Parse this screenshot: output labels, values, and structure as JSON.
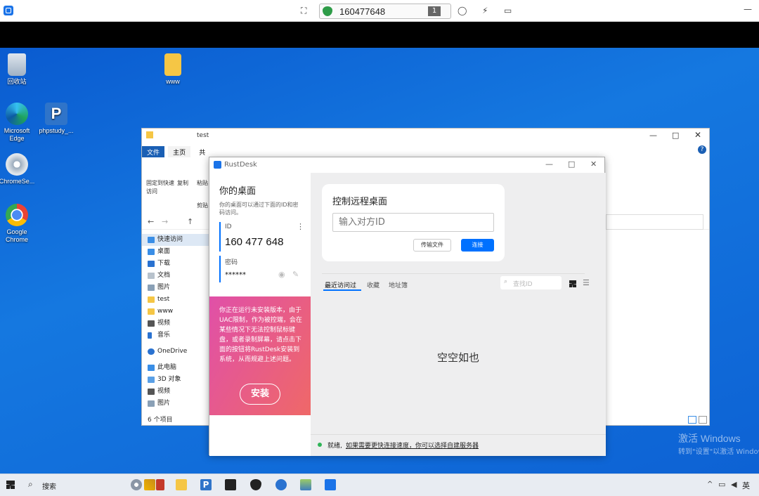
{
  "remote_toolbar": {
    "peer_id": "160477648",
    "monitor_number": "1",
    "minimize_glyph": "—"
  },
  "desktop": {
    "icons": [
      {
        "label": "回收站"
      },
      {
        "label": "www"
      },
      {
        "label": "Microsoft Edge"
      },
      {
        "label": "phpstudy_..."
      },
      {
        "label": "ChromeSe..."
      },
      {
        "label": "Google Chrome"
      }
    ],
    "watermark_line1": "激活 Windows",
    "watermark_line2": "转到\"设置\"以激活 Windows"
  },
  "explorer": {
    "title_path": "test",
    "tabs": [
      "文件",
      "主页",
      "共"
    ],
    "ribbon": {
      "pin": "固定到快速访问",
      "copy": "复制",
      "paste": "粘贴",
      "paste2": "剪贴"
    },
    "nav": [
      {
        "label": "快速访问"
      },
      {
        "label": "桌面"
      },
      {
        "label": "下载"
      },
      {
        "label": "文档"
      },
      {
        "label": "图片"
      },
      {
        "label": "test"
      },
      {
        "label": "www"
      },
      {
        "label": "视频"
      },
      {
        "label": "音乐"
      },
      {
        "label": "OneDrive"
      },
      {
        "label": "此电脑"
      },
      {
        "label": "3D 对象"
      },
      {
        "label": "视频"
      },
      {
        "label": "图片"
      }
    ],
    "status": "6 个项目"
  },
  "rustdesk": {
    "title": "RustDesk",
    "your_desktop": "你的桌面",
    "your_desktop_desc": "你的桌面可以通过下面的ID和密码访问。",
    "id_label": "ID",
    "id_value": "160 477 648",
    "password_label": "密码",
    "password_value": "******",
    "warning_text": "你正在运行未安装版本，由于UAC限制，作为被控端，会在某些情况下无法控制鼠标键盘，或者录制屏幕，请点击下面的按钮将RustDesk安装到系统，从而规避上述问题。",
    "install_button": "安装",
    "control_title": "控制远程桌面",
    "remote_id_placeholder": "输入对方ID",
    "transfer_button": "传输文件",
    "connect_button": "连接",
    "tabs": [
      "最近访问过",
      "收藏",
      "地址簿"
    ],
    "search_placeholder": "查找ID",
    "empty_text": "空空如也",
    "status_prefix": "就绪,",
    "status_link": "如果需要更快连接速度，你可以选择自建服务器",
    "accent": "#0071ff"
  },
  "taskbar": {
    "search": "搜索",
    "tray_lang": "英"
  }
}
